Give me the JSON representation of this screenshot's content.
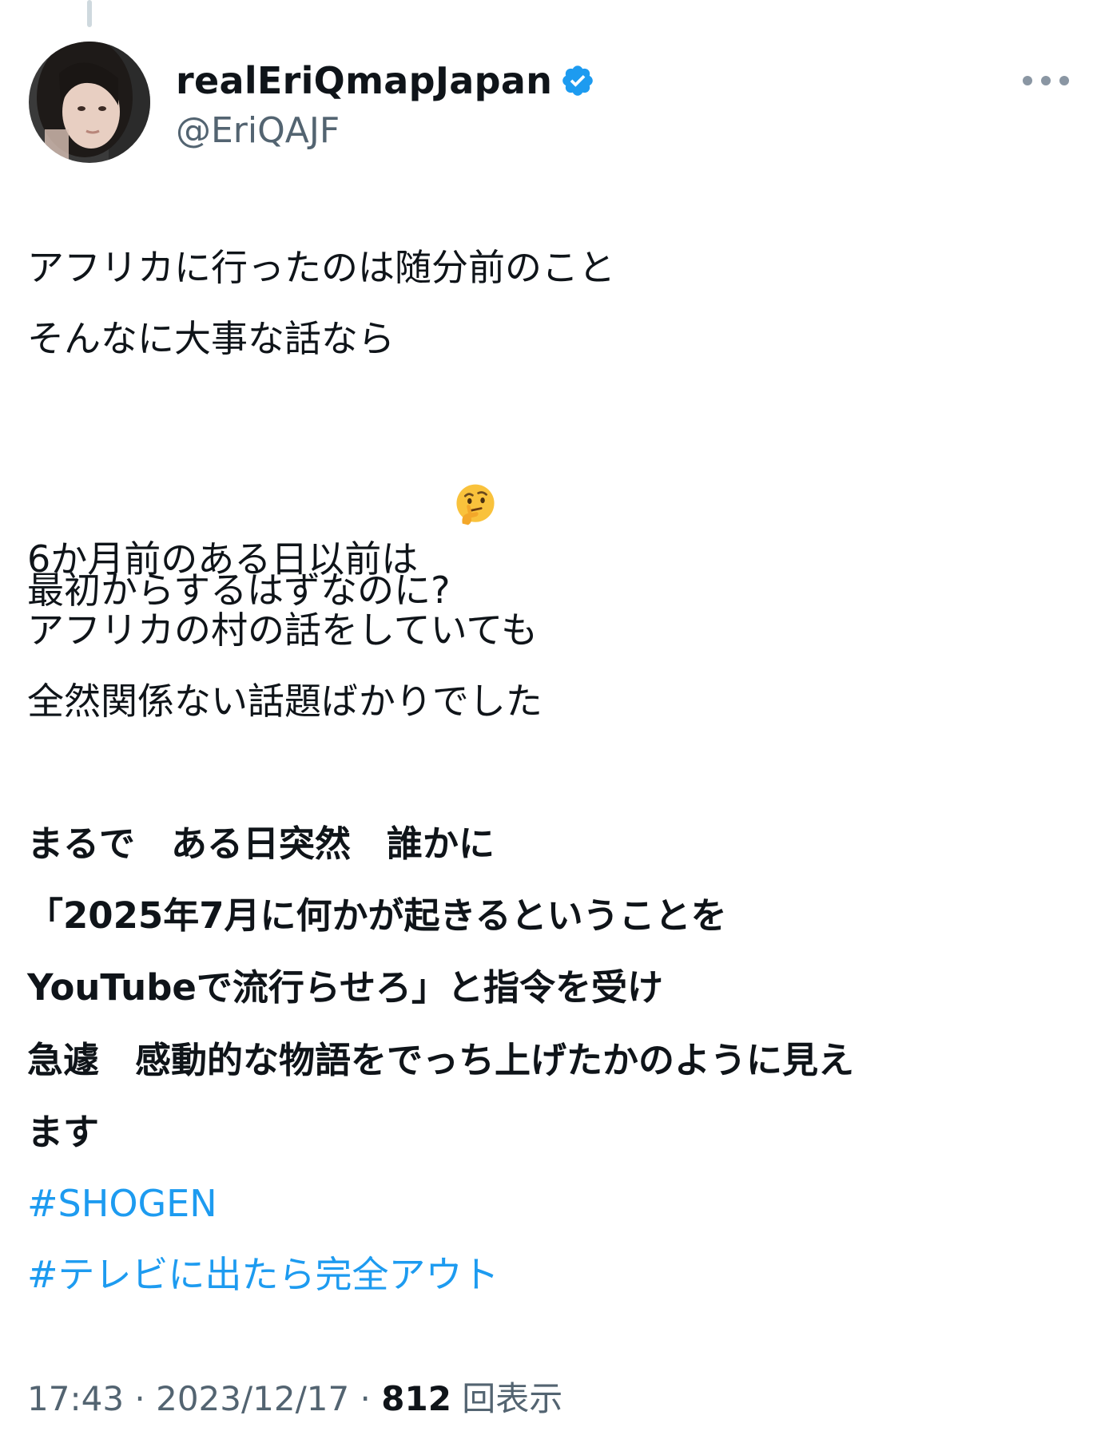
{
  "tweet": {
    "author": {
      "display_name": "realEriQmapJapan",
      "handle": "@EriQAJF",
      "verified": true,
      "verified_color": "#1d9bf0"
    },
    "body_lines": [
      "アフリカに行ったのは随分前のこと",
      "そんなに大事な話なら",
      "最初からするはずなのに?",
      "6か月前のある日以前は",
      "アフリカの村の話をしていても",
      "全然関係ない話題ばかりでした",
      "まるで　ある日突然　誰かに",
      "「2025年7月に何かが起きるということを",
      "YouTubeで流行らせろ」と指令を受け",
      "急遽　感動的な物語をでっち上げたかのように見え",
      "ます"
    ],
    "hashtags": [
      "#SHOGEN",
      "#テレビに出たら完全アウト"
    ],
    "hashtag_color": "#1d9bf0",
    "emoji": "thinking-face-icon",
    "time": "17:43",
    "separator": " · ",
    "date": "2023/12/17",
    "views_count": "812",
    "views_label": "回表示"
  }
}
